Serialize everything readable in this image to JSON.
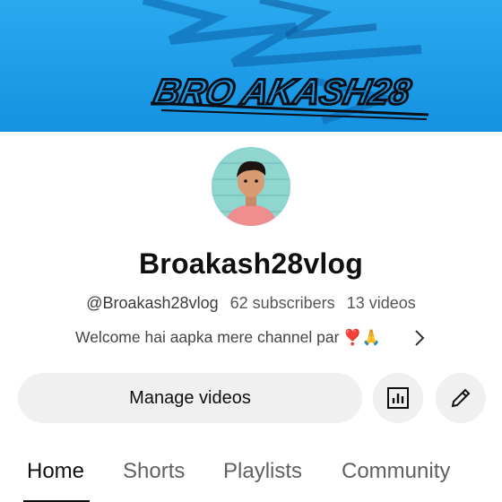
{
  "banner": {
    "text": "BRO AKASH28"
  },
  "channel": {
    "name": "Broakash28vlog",
    "handle": "@Broakash28vlog",
    "subscribers": "62 subscribers",
    "videos": "13 videos",
    "description": "Welcome hai aapka mere channel par",
    "description_emoji": "❣️🙏"
  },
  "actions": {
    "manage_label": "Manage videos"
  },
  "tabs": [
    {
      "label": "Home",
      "active": true
    },
    {
      "label": "Shorts",
      "active": false
    },
    {
      "label": "Playlists",
      "active": false
    },
    {
      "label": "Community",
      "active": false
    }
  ],
  "icons": {
    "stats": "bar-chart-icon",
    "edit": "pencil-icon",
    "chevron": "chevron-right-icon"
  },
  "colors": {
    "banner": "#1a9be6",
    "button_bg": "#f0f0f0"
  }
}
